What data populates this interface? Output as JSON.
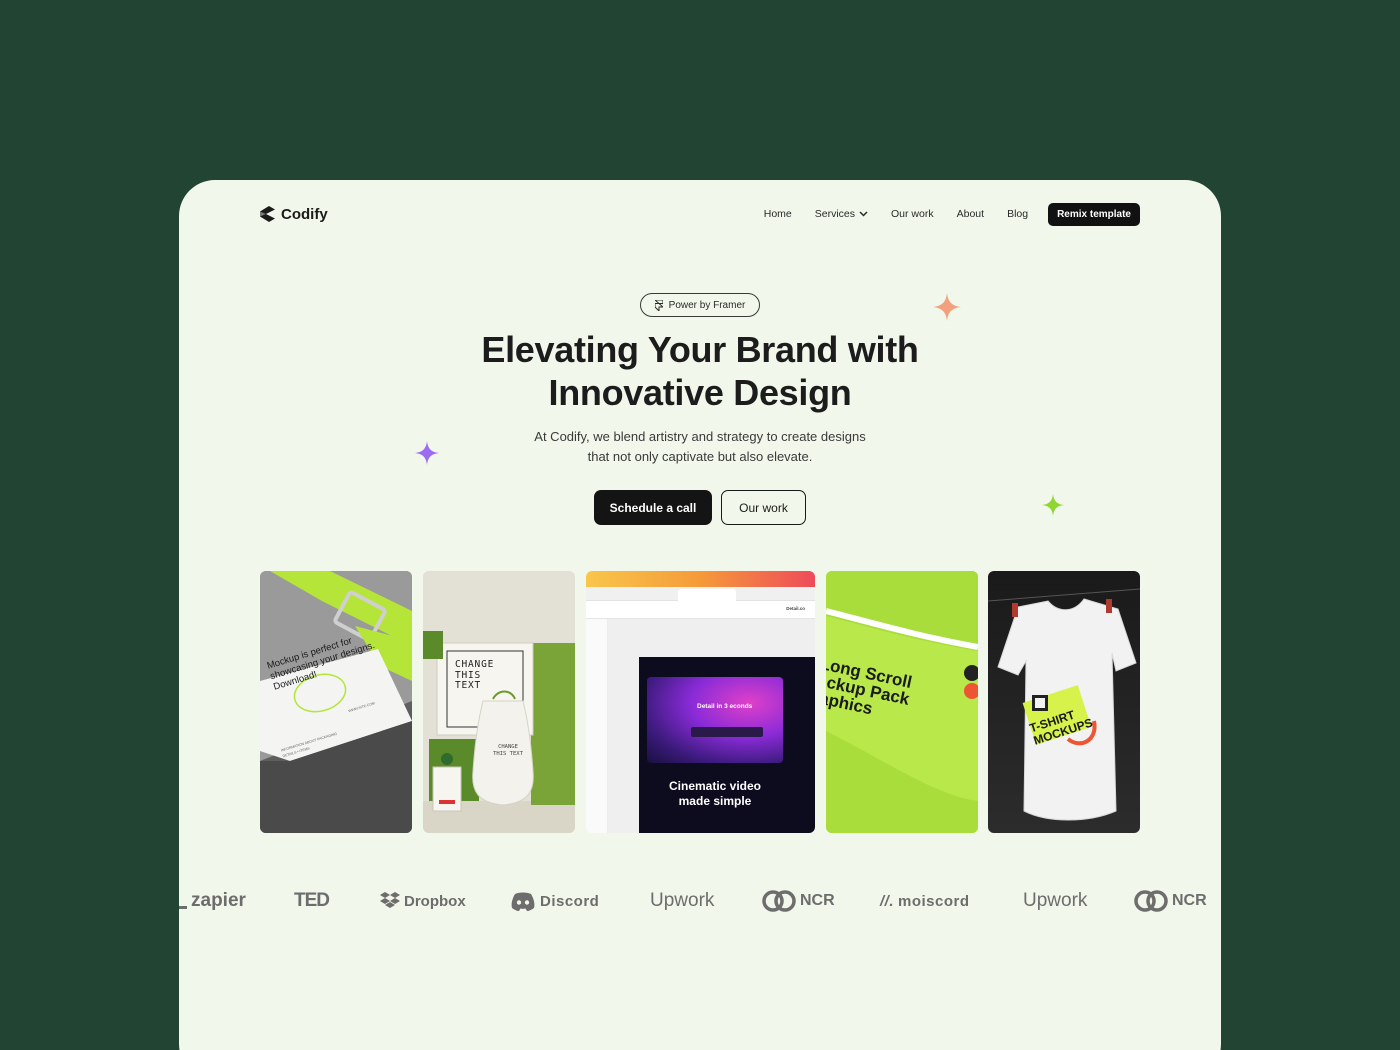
{
  "brand": {
    "name": "Codify"
  },
  "nav": {
    "items": [
      "Home",
      "Services",
      "Our work",
      "About",
      "Blog"
    ],
    "cta": "Remix template"
  },
  "hero": {
    "badge": "Power by Framer",
    "headline_line1": "Elevating Your Brand with",
    "headline_line2": "Innovative Design",
    "subtitle_line1": "At Codify, we blend artistry and strategy to create designs",
    "subtitle_line2": "that not only captivate but also elevate.",
    "primary_cta": "Schedule a call",
    "secondary_cta": "Our work"
  },
  "gallery": {
    "tile1": {
      "text_line1": "Mockup is perfect for",
      "text_line2": "showcasing your designs.",
      "text_line3": "Download!"
    },
    "tile2": {
      "sign_line1": "CHANGE",
      "sign_line2": "THIS",
      "sign_line3": "TEXT",
      "bag_line1": "CHANGE",
      "bag_line2": "THIS TEXT"
    },
    "tile3": {
      "video_title": "Detail in 3",
      "video_title_tail": "econds",
      "caption_line1": "Cinematic video",
      "caption_line2": "made simple",
      "url": "Detail.co"
    },
    "tile4": {
      "line1": "Long Scroll",
      "line2": "ockup Pack",
      "line3": "raphics"
    },
    "tile5": {
      "line1": "T-SHIRT",
      "line2": "MOCKUPS"
    }
  },
  "logos": [
    "zapier",
    "TED",
    "Dropbox",
    "Discord",
    "Upwork",
    "NCR",
    "moiscord",
    "Upwork",
    "NCR"
  ],
  "colors": {
    "background": "#224433",
    "card": "#f1f7ea",
    "spark_orange": "#f2a07e",
    "spark_purple": "#9b6cf2",
    "spark_green": "#8fd632",
    "lime": "#a4d93a"
  }
}
